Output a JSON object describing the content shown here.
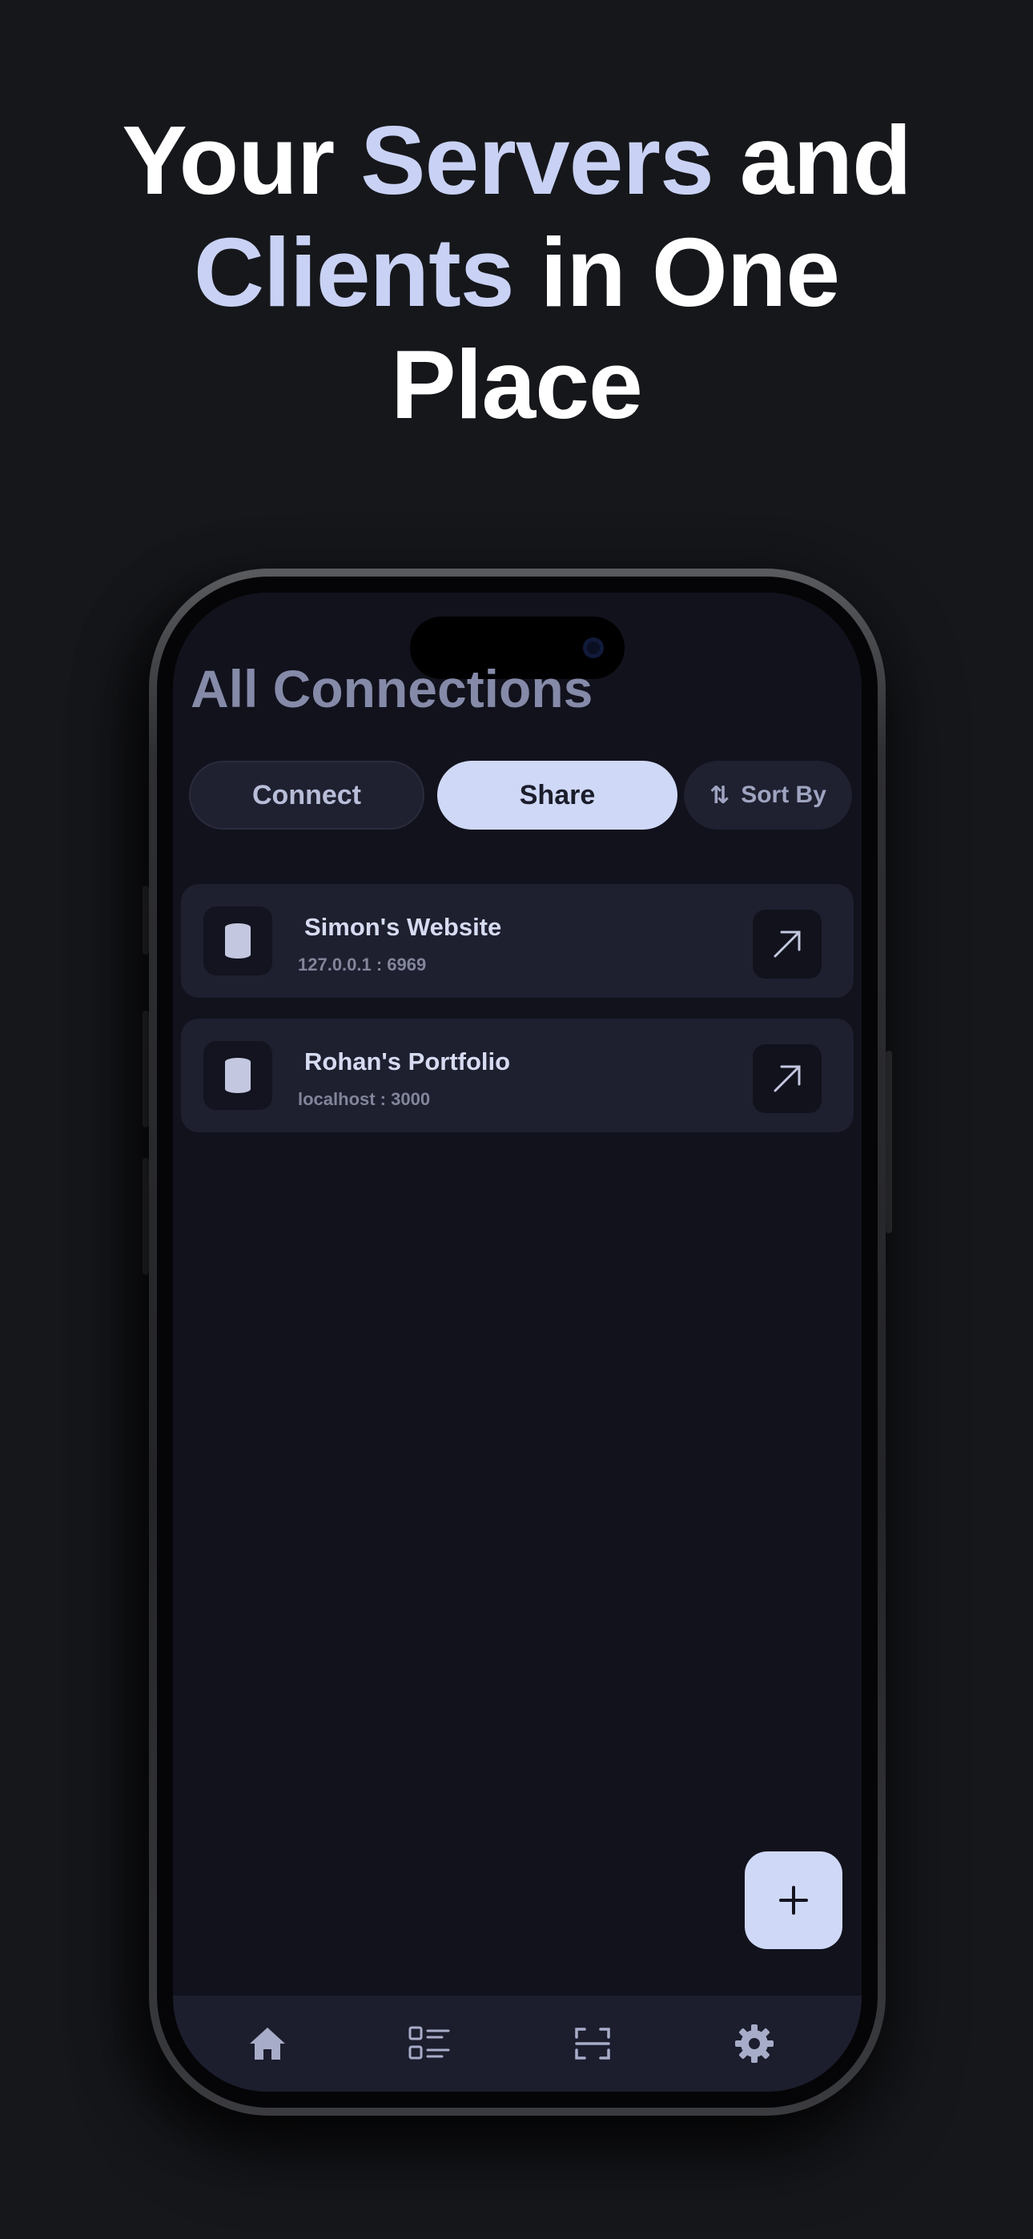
{
  "headline": {
    "part1": "Your ",
    "accent1": "Servers",
    "part2": " and",
    "accent2": "Clients",
    "part3": " in One",
    "part4": "Place"
  },
  "app": {
    "title": "All Connections",
    "segments": {
      "connect": "Connect",
      "share": "Share",
      "active": "share"
    },
    "sort_label": "Sort By",
    "connections": [
      {
        "name": "Simon's Website",
        "address": "127.0.0.1 : 6969",
        "icon": "database-icon"
      },
      {
        "name": "Rohan's Portfolio",
        "address": "localhost : 3000",
        "icon": "database-icon"
      }
    ],
    "nav": [
      {
        "icon": "home-icon"
      },
      {
        "icon": "list-icon"
      },
      {
        "icon": "scan-icon"
      },
      {
        "icon": "gear-icon"
      }
    ]
  },
  "colors": {
    "background": "#16171b",
    "accent": "#c9d2f4",
    "screen": "#11121c",
    "card": "#1e1f2f"
  }
}
